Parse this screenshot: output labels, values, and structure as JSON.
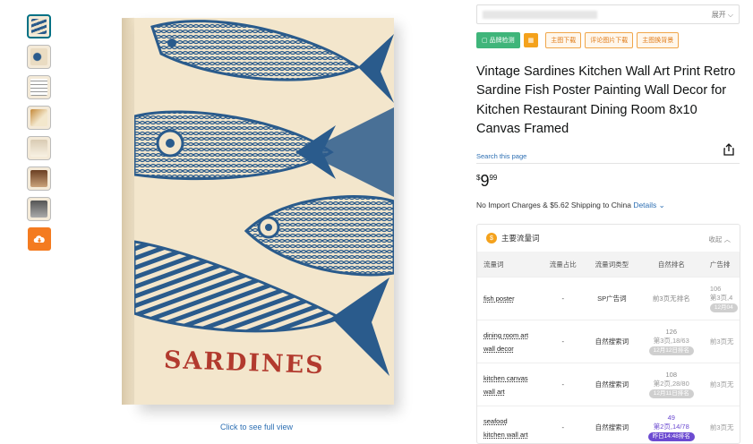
{
  "thumbnails": [
    {
      "name": "thumb-1"
    },
    {
      "name": "thumb-2"
    },
    {
      "name": "thumb-3"
    },
    {
      "name": "thumb-4"
    },
    {
      "name": "thumb-5"
    },
    {
      "name": "thumb-6"
    },
    {
      "name": "thumb-7"
    }
  ],
  "download_icon": "cloud-download-icon",
  "image": {
    "poster_text": "SARDINES",
    "see_full_label": "Click to see full view"
  },
  "search": {
    "expand_label": "展开"
  },
  "tags": {
    "brand_check": "品牌检测",
    "main_image_download": "主图下载",
    "review_image_download": "评论图片下载",
    "main_image_background": "主图换背景"
  },
  "product": {
    "title": "Vintage Sardines Kitchen Wall Art Print Retro Sardine Fish Poster Painting Wall Decor for Kitchen Restaurant Dining Room 8x10 Canvas Framed",
    "search_this_page": "Search this page",
    "price_currency": "$",
    "price_whole": "9",
    "price_fraction": "99",
    "shipping_text": "No Import Charges & $5.62 Shipping to China",
    "details_label": "Details"
  },
  "traffic_panel": {
    "title": "主要流量词",
    "collapse_label": "收起",
    "columns": [
      "流量词",
      "流量占比",
      "流量词类型",
      "自然排名",
      "广告排"
    ],
    "rows": [
      {
        "keyword_lines": [
          "fish poster"
        ],
        "share": "-",
        "type": "SP广告词",
        "rank_main": "前3页无排名",
        "rank_sub": "",
        "rank_date": "",
        "ad_lines": [
          "106",
          "第3页,4",
          "12月04"
        ]
      },
      {
        "keyword_lines": [
          "dining room art",
          "wall decor"
        ],
        "share": "-",
        "type": "自然搜索词",
        "rank_main": "126",
        "rank_sub": "第3页,18/63",
        "rank_date": "12月12日排名",
        "ad_lines": [
          "前3页无"
        ]
      },
      {
        "keyword_lines": [
          "kitchen canvas",
          "wall art"
        ],
        "share": "-",
        "type": "自然搜索词",
        "rank_main": "108",
        "rank_sub": "第2页,28/80",
        "rank_date": "12月11日排名",
        "ad_lines": [
          "前3页无"
        ]
      },
      {
        "keyword_lines": [
          "seafood",
          "kitchen wall art"
        ],
        "share": "-",
        "type": "自然搜索词",
        "rank_main": "49",
        "rank_sub": "第2页,14/78",
        "rank_date": "昨日14:48排名",
        "ad_lines": [
          "前3页无"
        ]
      }
    ]
  }
}
